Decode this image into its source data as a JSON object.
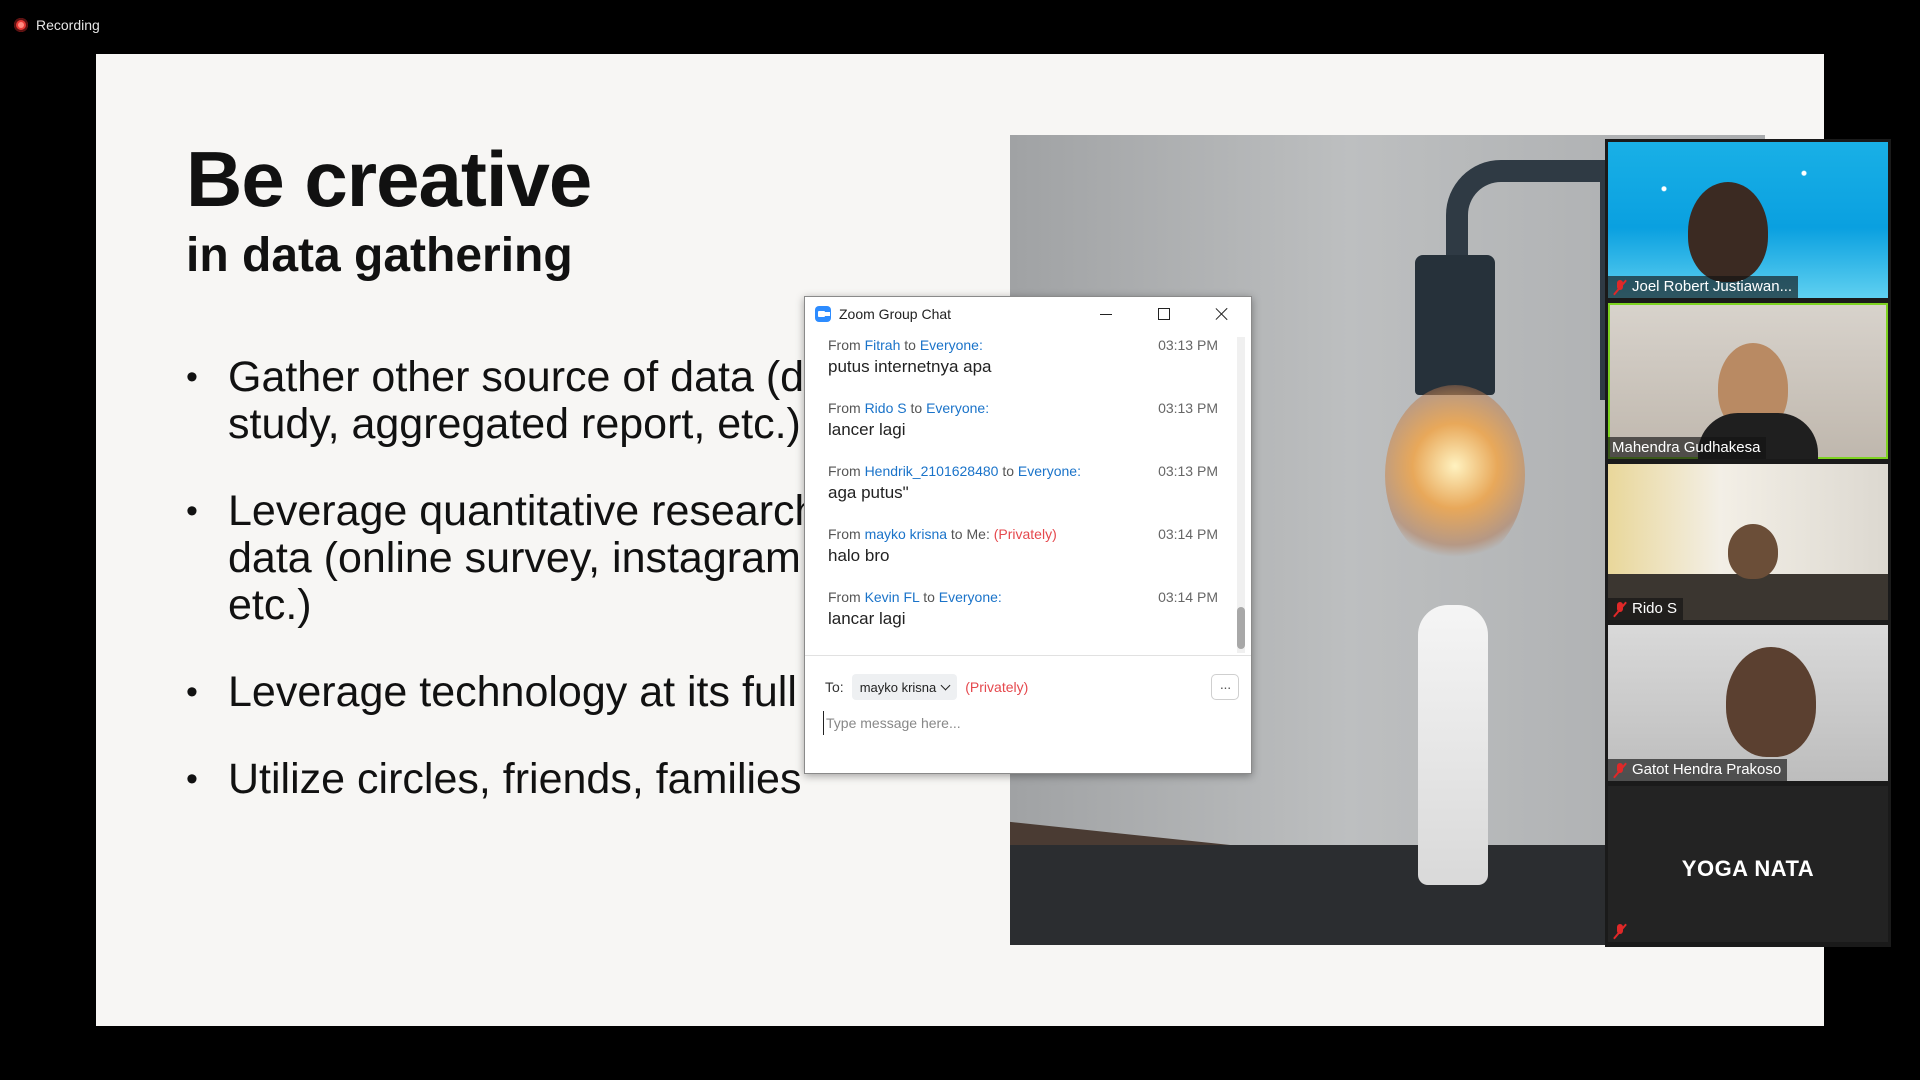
{
  "recording": {
    "label": "Recording"
  },
  "slide": {
    "title": "Be creative",
    "subtitle": "in data gathering",
    "bullets": [
      "Gather other source of data (d\nstudy, aggregated report, etc.)",
      "Leverage quantitative research\ndata (online survey, instagram\netc.)",
      "Leverage technology at its full",
      "Utilize circles, friends, families"
    ]
  },
  "participants": [
    {
      "name": "Joel Robert Justiawan...",
      "muted": true
    },
    {
      "name": "Mahendra Gudhakesa",
      "muted": false,
      "active_speaker": true
    },
    {
      "name": "Rido S",
      "muted": true
    },
    {
      "name": "Gatot Hendra Prakoso",
      "muted": true
    },
    {
      "name": "YOGA NATA",
      "muted": true,
      "video_off": true
    }
  ],
  "chat": {
    "title": "Zoom Group Chat",
    "messages": [
      {
        "from_label": "From",
        "sender": "Fitrah",
        "to_label": "to",
        "recipient": "Everyone:",
        "time": "03:13 PM",
        "text": "putus internetnya apa"
      },
      {
        "from_label": "From",
        "sender": "Rido S",
        "to_label": "to",
        "recipient": "Everyone:",
        "time": "03:13 PM",
        "text": "lancer lagi"
      },
      {
        "from_label": "From",
        "sender": "Hendrik_2101628480",
        "to_label": "to",
        "recipient": "Everyone:",
        "time": "03:13 PM",
        "text": "aga putus\""
      },
      {
        "from_label": "From",
        "sender": "mayko krisna",
        "to_label": "to",
        "recipient": "Me:",
        "private_tag": "(Privately)",
        "time": "03:14 PM",
        "text": "halo bro"
      },
      {
        "from_label": "From",
        "sender": "Kevin FL",
        "to_label": "to",
        "recipient": "Everyone:",
        "time": "03:14 PM",
        "text": "lancar lagi"
      }
    ],
    "to_label": "To:",
    "recipient_selected": "mayko krisna",
    "privately_label": "(Privately)",
    "more_label": "···",
    "input_placeholder": "Type message here..."
  }
}
